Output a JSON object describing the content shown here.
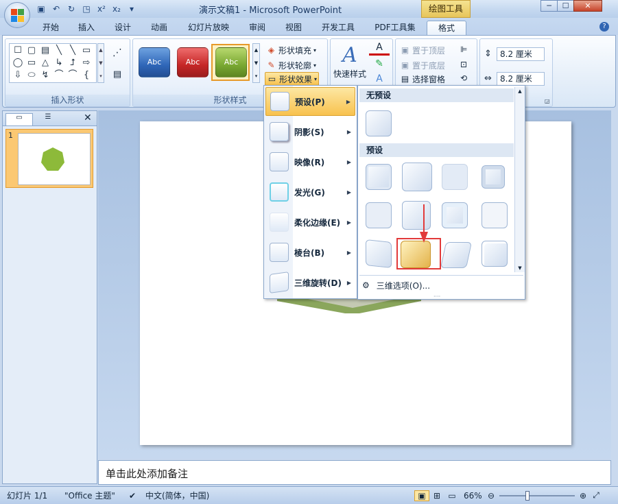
{
  "title": "演示文稿1 - Microsoft PowerPoint",
  "contextual_tab": "绘图工具",
  "window_controls": {
    "minimize": "─",
    "maximize": "☐",
    "close": "✕"
  },
  "tabs": [
    "开始",
    "插入",
    "设计",
    "动画",
    "幻灯片放映",
    "审阅",
    "视图",
    "开发工具",
    "PDF工具集",
    "格式"
  ],
  "active_tab": "格式",
  "ribbon": {
    "insert_shapes": {
      "label": "插入形状",
      "gallery_glyphs": [
        "☐",
        "▢",
        "▤",
        "╲",
        "╲",
        "▭",
        "◯",
        "▭",
        "△",
        "↳",
        "⮥",
        "⇨",
        "⇩",
        "⬭",
        "↯",
        "⌒",
        "⌒",
        "{"
      ]
    },
    "shape_styles": {
      "label": "形状样式",
      "styles": [
        "Abc",
        "Abc",
        "Abc"
      ],
      "fill": "形状填充",
      "outline": "形状轮廓",
      "effects": "形状效果"
    },
    "wordart": {
      "quick_styles": "快速样式"
    },
    "arrange": {
      "bring_front": "置于顶层",
      "send_back": "置于底层",
      "selection_pane": "选择窗格"
    },
    "size": {
      "height": "8.2 厘米",
      "width": "8.2 厘米"
    }
  },
  "slide_panel": {
    "slide_number": "1"
  },
  "notes_placeholder": "单击此处添加备注",
  "effects_menu": [
    {
      "label": "预设(P)",
      "highlighted": true
    },
    {
      "label": "阴影(S)"
    },
    {
      "label": "映像(R)"
    },
    {
      "label": "发光(G)"
    },
    {
      "label": "柔化边缘(E)"
    },
    {
      "label": "棱台(B)"
    },
    {
      "label": "三维旋转(D)"
    }
  ],
  "preset_panel": {
    "no_preset_header": "无预设",
    "preset_header": "预设",
    "options_link": "三维选项(O)..."
  },
  "status": {
    "slide": "幻灯片 1/1",
    "theme": "\"Office 主题\"",
    "language": "中文(简体，中国)",
    "zoom": "66%"
  },
  "colors": {
    "accent_orange": "#f8c24e",
    "shape_green": "#8dba3a",
    "annotation_red": "#e23a3a"
  }
}
